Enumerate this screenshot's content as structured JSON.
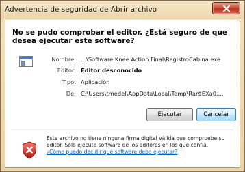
{
  "window": {
    "title": "Advertencia de seguridad de Abrir archivo"
  },
  "heading": "No se pudo comprobar el editor. ¿Está seguro de que desea ejecutar este software?",
  "details": [
    {
      "label": "Nombre:",
      "value": "...\\Software Knee Action Final\\RegistroCabina.exe",
      "bold": false
    },
    {
      "label": "Editor:",
      "value": "Editor desconocido",
      "bold": true
    },
    {
      "label": "Tipo:",
      "value": "Aplicación",
      "bold": false
    },
    {
      "label": "De:",
      "value": "C:\\Users\\tmedel\\AppData\\Local\\Temp\\Rar$EXa0....",
      "bold": false
    }
  ],
  "buttons": {
    "run": "Ejecutar",
    "cancel": "Cancelar"
  },
  "warning": {
    "text": "Este archivo no tiene ninguna firma digital válida que compruebe su editor. Sólo ejecute software de los editores en los que confía.",
    "link": "¿Cómo puedo decidir qué software debo ejecutar?"
  },
  "icons": {
    "close": "close-icon",
    "file": "application-file-icon",
    "shield": "security-shield-icon"
  }
}
